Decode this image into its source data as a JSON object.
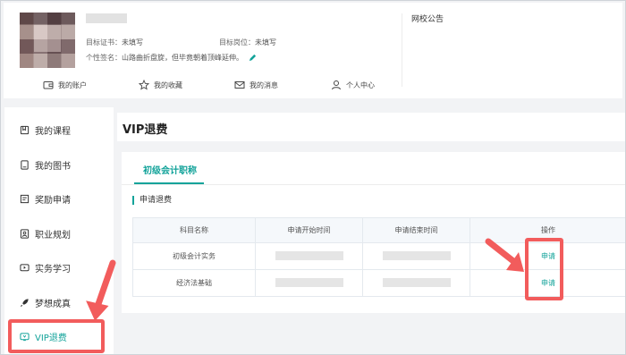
{
  "profile": {
    "target_cert_label": "目标证书：",
    "target_cert_value": "未填写",
    "target_post_label": "目标岗位：",
    "target_post_value": "未填写",
    "signature_label": "个性签名：",
    "signature_value": "山路曲折盘旋，但毕竟朝着顶峰延伸。"
  },
  "notice": {
    "title": "网校公告"
  },
  "top_nav": [
    {
      "label": "我的账户",
      "icon": "wallet-icon"
    },
    {
      "label": "我的收藏",
      "icon": "star-icon"
    },
    {
      "label": "我的消息",
      "icon": "mail-icon"
    },
    {
      "label": "个人中心",
      "icon": "user-icon"
    }
  ],
  "sidebar": {
    "items": [
      {
        "label": "我的课程",
        "icon": "course-icon"
      },
      {
        "label": "我的图书",
        "icon": "book-icon"
      },
      {
        "label": "奖励申请",
        "icon": "reward-icon"
      },
      {
        "label": "职业规划",
        "icon": "career-icon"
      },
      {
        "label": "实务学习",
        "icon": "practice-icon"
      },
      {
        "label": "梦想成真",
        "icon": "rocket-icon"
      },
      {
        "label": "VIP退费",
        "icon": "vip-icon"
      }
    ],
    "active_index": 6
  },
  "main": {
    "title": "VIP退费",
    "tab": "初级会计职称",
    "section": "申请退费",
    "table": {
      "headers": [
        "科目名称",
        "申请开始时间",
        "申请结束时间",
        "操作"
      ],
      "rows": [
        {
          "subject": "初级会计实务",
          "action": "申请"
        },
        {
          "subject": "经济法基础",
          "action": "申请"
        }
      ]
    }
  },
  "colors": {
    "accent": "#13a39a",
    "annotation": "#f25c5c"
  }
}
